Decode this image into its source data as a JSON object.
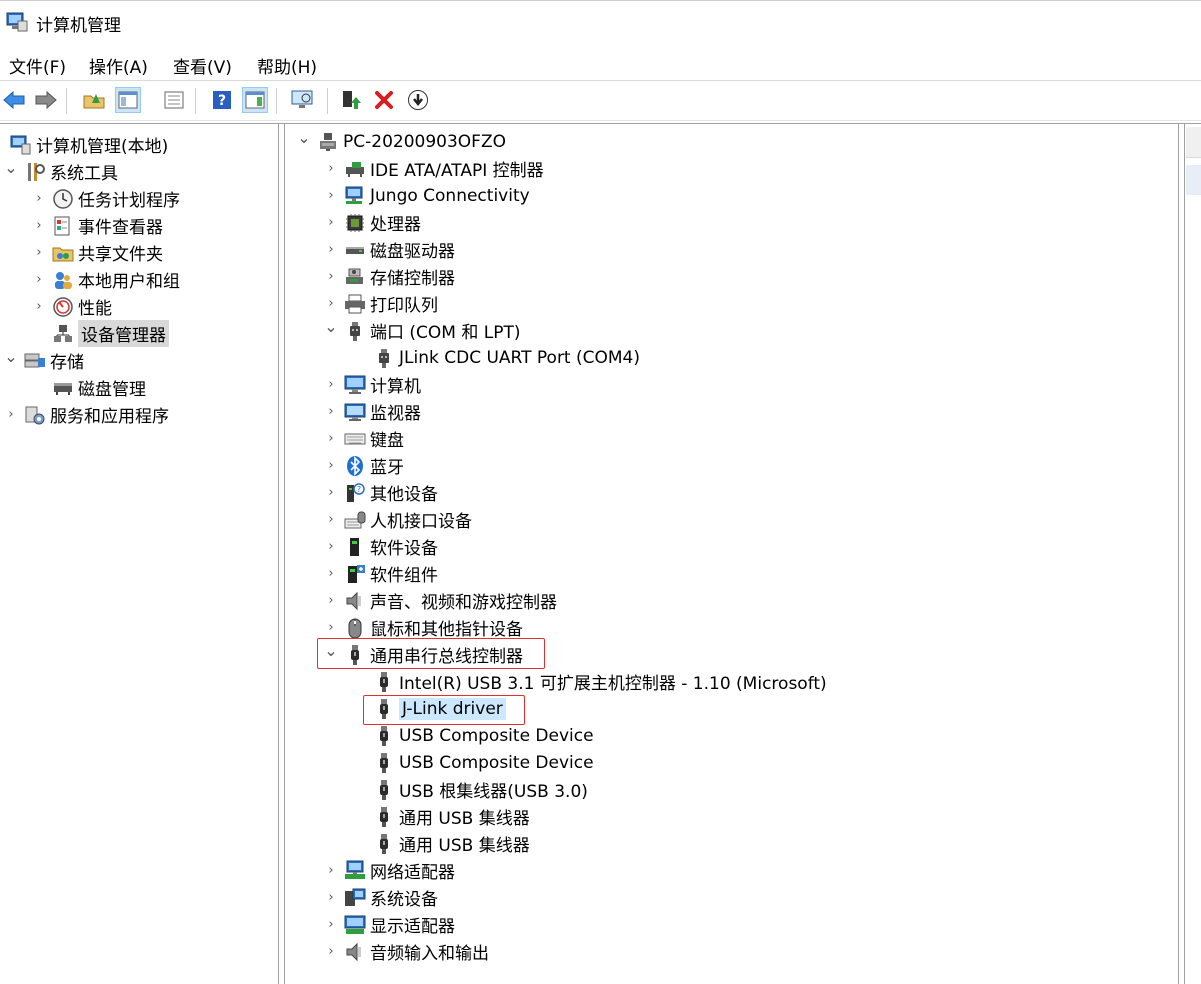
{
  "window": {
    "title": "计算机管理"
  },
  "menu": [
    "文件(F)",
    "操作(A)",
    "查看(V)",
    "帮助(H)"
  ],
  "toolbar": {
    "buttons": [
      {
        "name": "back-arrow-icon"
      },
      {
        "name": "forward-arrow-icon"
      },
      {
        "name": "up-folder-icon"
      },
      {
        "name": "show-hide-console-tree-icon"
      },
      {
        "name": "properties-icon"
      },
      {
        "name": "help-icon"
      },
      {
        "name": "show-hide-action-pane-icon"
      },
      {
        "name": "monitor-icon"
      },
      {
        "name": "update-driver-icon"
      },
      {
        "name": "uninstall-x-icon"
      },
      {
        "name": "download-circle-icon"
      }
    ]
  },
  "left_tree": [
    {
      "label": "计算机管理(本地)",
      "icon": "computer-management-icon",
      "chev": ""
    },
    {
      "label": "系统工具",
      "icon": "system-tools-icon",
      "chev": "⌄"
    },
    {
      "label": "任务计划程序",
      "icon": "clock-icon",
      "chev": "›"
    },
    {
      "label": "事件查看器",
      "icon": "event-viewer-icon",
      "chev": "›"
    },
    {
      "label": "共享文件夹",
      "icon": "shared-folder-icon",
      "chev": "›"
    },
    {
      "label": "本地用户和组",
      "icon": "users-icon",
      "chev": "›"
    },
    {
      "label": "性能",
      "icon": "performance-icon",
      "chev": "›"
    },
    {
      "label": "设备管理器",
      "icon": "device-manager-icon",
      "chev": ""
    },
    {
      "label": "存储",
      "icon": "storage-icon",
      "chev": "⌄"
    },
    {
      "label": "磁盘管理",
      "icon": "disk-management-icon",
      "chev": ""
    },
    {
      "label": "服务和应用程序",
      "icon": "services-icon",
      "chev": "›"
    }
  ],
  "device_tree": {
    "root": "PC-20200903OFZO",
    "items": [
      {
        "label": "IDE ATA/ATAPI 控制器",
        "icon": "ide-controller-icon",
        "chev": "›"
      },
      {
        "label": "Jungo Connectivity",
        "icon": "network-monitor-icon",
        "chev": "›"
      },
      {
        "label": "处理器",
        "icon": "processor-icon",
        "chev": "›"
      },
      {
        "label": "磁盘驱动器",
        "icon": "disk-drive-icon",
        "chev": "›"
      },
      {
        "label": "存储控制器",
        "icon": "storage-controller-icon",
        "chev": "›"
      },
      {
        "label": "打印队列",
        "icon": "printer-icon",
        "chev": "›"
      },
      {
        "label": "端口 (COM 和 LPT)",
        "icon": "port-icon",
        "chev": "⌄"
      },
      {
        "label": "JLink CDC UART Port (COM4)",
        "icon": "port-icon",
        "chev": "",
        "child": true
      },
      {
        "label": "计算机",
        "icon": "computer-icon",
        "chev": "›"
      },
      {
        "label": "监视器",
        "icon": "monitor-icon",
        "chev": "›"
      },
      {
        "label": "键盘",
        "icon": "keyboard-icon",
        "chev": "›"
      },
      {
        "label": "蓝牙",
        "icon": "bluetooth-icon",
        "chev": "›"
      },
      {
        "label": "其他设备",
        "icon": "unknown-device-icon",
        "chev": "›"
      },
      {
        "label": "人机接口设备",
        "icon": "hid-icon",
        "chev": "›"
      },
      {
        "label": "软件设备",
        "icon": "software-device-icon",
        "chev": "›"
      },
      {
        "label": "软件组件",
        "icon": "software-component-icon",
        "chev": "›"
      },
      {
        "label": "声音、视频和游戏控制器",
        "icon": "speaker-icon",
        "chev": "›"
      },
      {
        "label": "鼠标和其他指针设备",
        "icon": "mouse-icon",
        "chev": "›"
      },
      {
        "label": "通用串行总线控制器",
        "icon": "usb-icon",
        "chev": "⌄"
      },
      {
        "label": "Intel(R) USB 3.1 可扩展主机控制器 - 1.10 (Microsoft)",
        "icon": "usb-icon",
        "chev": "",
        "child": true
      },
      {
        "label": "J-Link driver",
        "icon": "usb-icon",
        "chev": "",
        "child": true
      },
      {
        "label": "USB Composite Device",
        "icon": "usb-icon",
        "chev": "",
        "child": true
      },
      {
        "label": "USB Composite Device",
        "icon": "usb-icon",
        "chev": "",
        "child": true
      },
      {
        "label": "USB 根集线器(USB 3.0)",
        "icon": "usb-icon",
        "chev": "",
        "child": true
      },
      {
        "label": "通用 USB 集线器",
        "icon": "usb-icon",
        "chev": "",
        "child": true
      },
      {
        "label": "通用 USB 集线器",
        "icon": "usb-icon",
        "chev": "",
        "child": true
      },
      {
        "label": "网络适配器",
        "icon": "network-adapter-icon",
        "chev": "›"
      },
      {
        "label": "系统设备",
        "icon": "system-device-icon",
        "chev": "›"
      },
      {
        "label": "显示适配器",
        "icon": "display-adapter-icon",
        "chev": "›"
      },
      {
        "label": "音频输入和输出",
        "icon": "speaker-icon",
        "chev": "›"
      }
    ]
  }
}
